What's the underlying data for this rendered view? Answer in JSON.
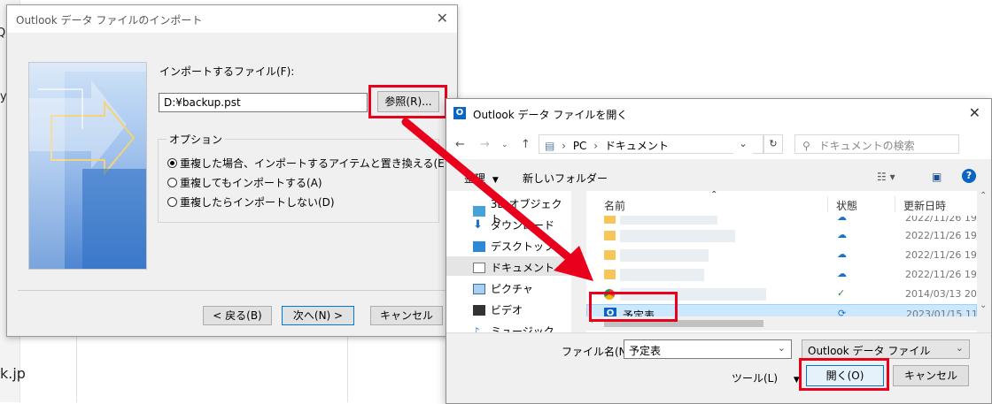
{
  "background": {
    "text_top": "Qu",
    "text_mid": "y",
    "text_bottom": "k.jp"
  },
  "wizard": {
    "title": "Outlook データ ファイルのインポート",
    "file_label": "インポートするファイル(F):",
    "file_value": "D:¥backup.pst",
    "browse_label": "参照(R)...",
    "options_title": "オプション",
    "options": [
      {
        "label": "重複した場合、インポートするアイテムと置き換える(E)",
        "selected": true
      },
      {
        "label": "重複してもインポートする(A)",
        "selected": false
      },
      {
        "label": "重複したらインポートしない(D)",
        "selected": false
      }
    ],
    "back_label": "< 戻る(B)",
    "next_label": "次へ(N) >",
    "cancel_label": "キャンセル"
  },
  "open_dialog": {
    "title": "Outlook データ ファイルを開く",
    "icon_letter": "O",
    "path": [
      "PC",
      "ドキュメント"
    ],
    "search_placeholder": "ドキュメントの検索",
    "toolbar": {
      "organize": "整理",
      "new_folder": "新しいフォルダー"
    },
    "nav_items": [
      {
        "label": "3D オブジェクト",
        "icon": "cube-icon"
      },
      {
        "label": "ダウンロード",
        "icon": "download-icon"
      },
      {
        "label": "デスクトップ",
        "icon": "desktop-icon"
      },
      {
        "label": "ドキュメント",
        "icon": "document-icon",
        "selected": true
      },
      {
        "label": "ピクチャ",
        "icon": "picture-icon"
      },
      {
        "label": "ビデオ",
        "icon": "video-icon"
      },
      {
        "label": "ミュージック",
        "icon": "music-icon"
      }
    ],
    "columns": {
      "name": "名前",
      "status": "状態",
      "modified": "更新日時"
    },
    "files": [
      {
        "name": "",
        "status": "☁",
        "date": "2022/11/26 19",
        "type": "folder"
      },
      {
        "name": "",
        "status": "☁",
        "date": "2022/11/26 19",
        "type": "folder"
      },
      {
        "name": "",
        "status": "☁",
        "date": "2022/11/26 19",
        "type": "folder"
      },
      {
        "name": "",
        "status": "☁",
        "date": "2022/11/26 19",
        "type": "folder"
      },
      {
        "name": "",
        "status": "✓",
        "date": "2014/03/13 20",
        "type": "chrome"
      },
      {
        "name": "予定表",
        "status": "⟳",
        "date": "2023/01/15 11",
        "type": "outlook",
        "selected": true
      }
    ],
    "filename_label": "ファイル名(N):",
    "filename_value": "予定表",
    "filetype_value": "Outlook データ ファイル",
    "tools_label": "ツール(L)",
    "open_label": "開く(O)",
    "cancel_label": "キャンセル"
  },
  "accent": {
    "highlight": "#e8001c",
    "selection": "#cce8ff"
  }
}
